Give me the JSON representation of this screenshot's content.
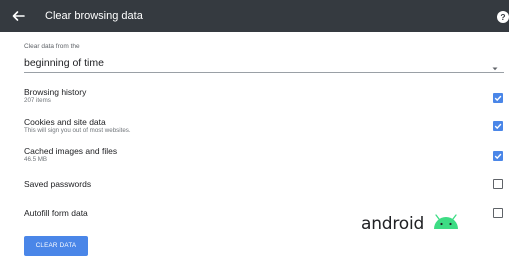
{
  "appbar": {
    "title": "Clear browsing data",
    "back_icon": "arrow-left-icon",
    "help_icon": "help-circle-icon",
    "background": "#353a40"
  },
  "time_range": {
    "label": "Clear data from the",
    "value": "beginning of time",
    "arrow_icon": "dropdown-triangle-icon"
  },
  "items": [
    {
      "title": "Browsing history",
      "subtitle": "207 items",
      "checked": true
    },
    {
      "title": "Cookies and site data",
      "subtitle": "This will sign you out of most websites.",
      "checked": true
    },
    {
      "title": "Cached images and files",
      "subtitle": "46.5 MB",
      "checked": true
    },
    {
      "title": "Saved passwords",
      "subtitle": "",
      "checked": false
    },
    {
      "title": "Autofill form data",
      "subtitle": "",
      "checked": false
    }
  ],
  "clear_button": {
    "label": "CLEAR DATA"
  },
  "watermark": {
    "text": "android",
    "robot_color": "#3ddc84"
  },
  "colors": {
    "accent": "#4a86e8",
    "checkbox_off_border": "#5f6368"
  }
}
